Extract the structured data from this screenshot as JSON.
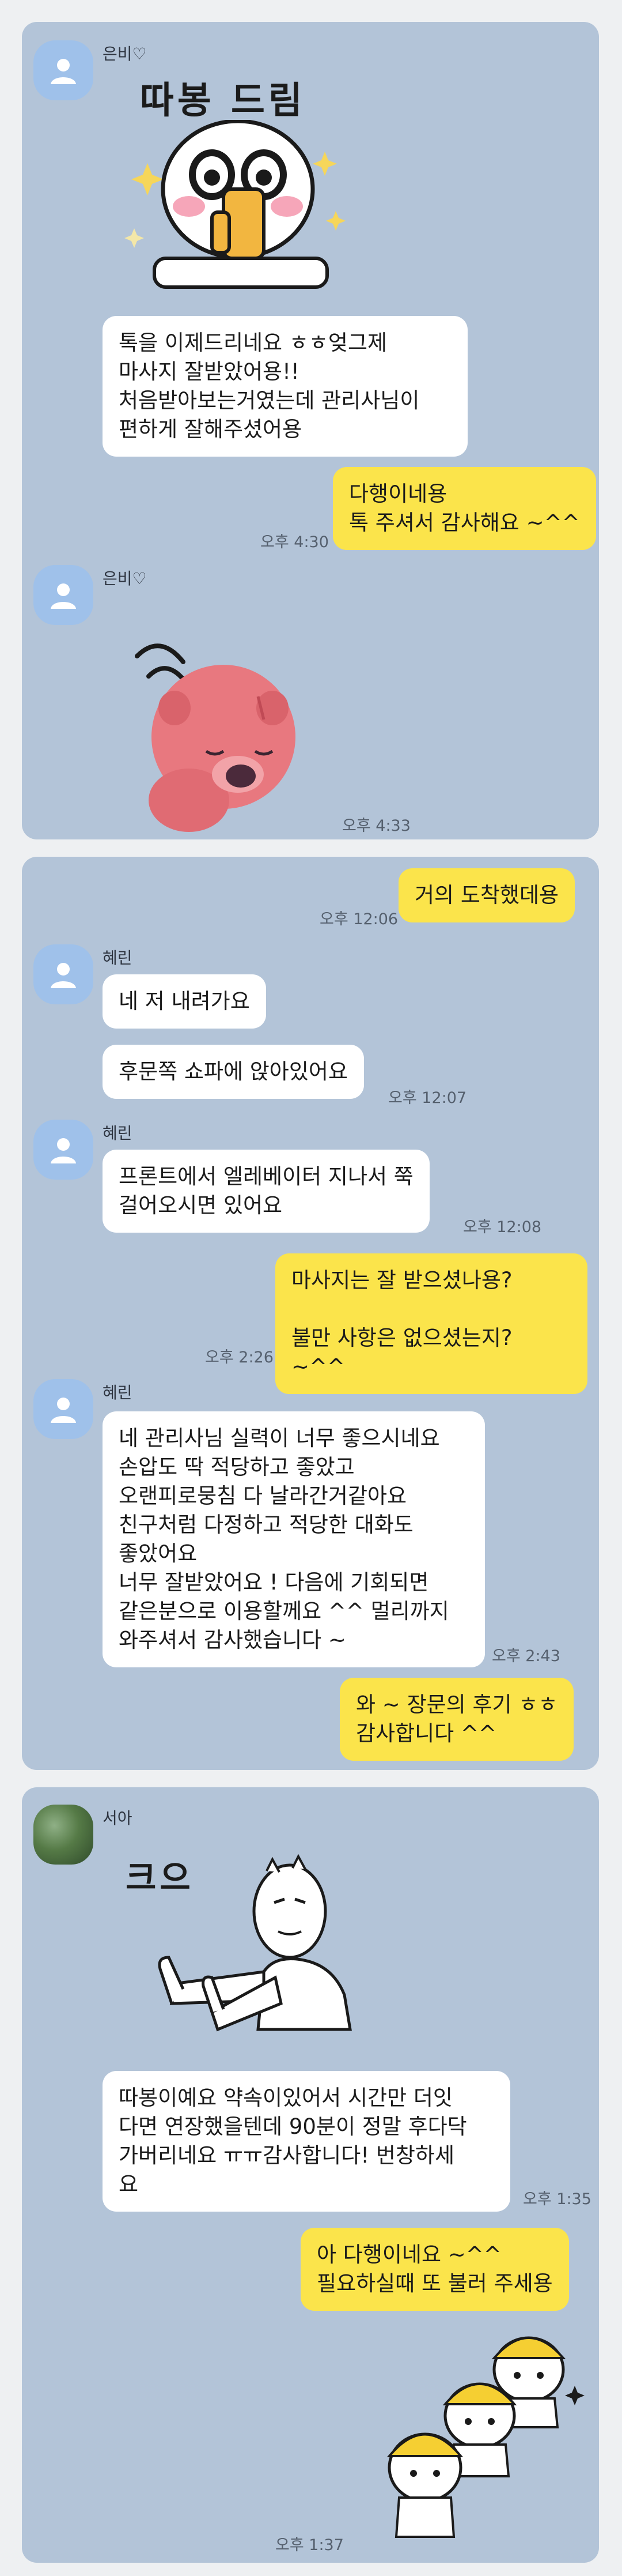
{
  "chat1": {
    "sender": "은비♡",
    "sticker1_text": "따봉 드림",
    "msg1": "톡을 이제드리네요 ㅎㅎ엊그제\n마사지 잘받았어용!!\n처음받아보는거였는데 관리사님이\n편하게 잘해주셨어용",
    "reply1": "다행이네용\n톡 주셔서 감사해요 ~^^",
    "reply1_time": "오후 4:30",
    "sender2": "은비♡",
    "sticker2_time": "오후 4:33"
  },
  "chat2": {
    "msg_me1": "거의 도착했데용",
    "msg_me1_time": "오후 12:06",
    "sender": "혜린",
    "msg1": "네 저 내려가요",
    "msg2": "후문쪽 쇼파에 앉아있어요",
    "msg2_time": "오후 12:07",
    "sender2": "혜린",
    "msg3": "프론트에서 엘레베이터 지나서 쭉\n걸어오시면 있어요",
    "msg3_time": "오후 12:08",
    "msg_me2": "마사지는 잘 받으셨나용?\n\n불만 사항은 없으셨는지? ~^^",
    "msg_me2_time": "오후 2:26",
    "sender3": "혜린",
    "msg4": "네 관리사님 실력이 너무 좋으시네요\n손압도 딱 적당하고 좋았고\n오랜피로뭉침 다 날라간거같아요\n친구처럼 다정하고 적당한 대화도\n좋았어요\n너무 잘받았어요 ! 다음에 기회되면\n같은분으로 이용할께요 ^^ 멀리까지\n와주셔서 감사했습니다 ~",
    "msg4_time": "오후 2:43",
    "msg_me3": "와 ~ 장문의 후기 ㅎㅎ\n감사합니다 ^^"
  },
  "chat3": {
    "sender": "서아",
    "sticker_text": "크으",
    "msg1": "따봉이예요 약속이있어서 시간만 더잇\n다면 연장했을텐데 90분이 정말 후다닥\n가버리네요 ㅠㅠ감사합니다! 번창하세\n요",
    "msg1_time": "오후 1:35",
    "reply1": "아 다행이네요 ~^^\n필요하실때 또 불러 주세용",
    "sticker_time": "오후 1:37"
  },
  "colors": {
    "chat_bg": "#b3c4d8",
    "my_bubble": "#fbe44b",
    "their_bubble": "#ffffff",
    "avatar_default": "#9fc1ea"
  }
}
